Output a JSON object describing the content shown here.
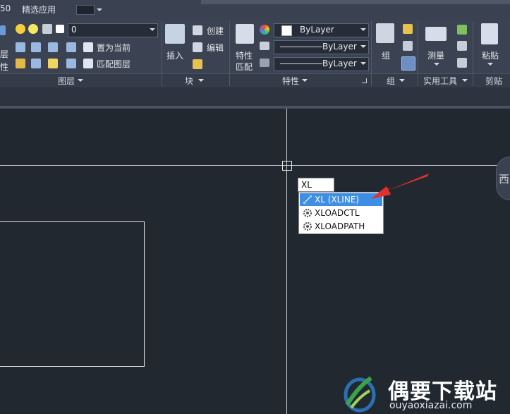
{
  "topbar": {
    "left_partial": "50",
    "menu_item": "精选应用"
  },
  "ribbon": {
    "layer": {
      "combo_value": "0",
      "labels": [
        "置为当前",
        "匹配图层"
      ],
      "left_cut_labels": [
        "层",
        "性"
      ],
      "group_label": "图层"
    },
    "block": {
      "insert_label": "插入",
      "create_label": "创建",
      "edit_label": "编辑",
      "group_label": "块"
    },
    "properties": {
      "match_label_1": "特性",
      "match_label_2": "匹配",
      "color_value": "ByLayer",
      "linetype_value": "ByLayer",
      "lineweight_value": "ByLayer",
      "group_label": "特性"
    },
    "group": {
      "label": "组",
      "group_label": "组"
    },
    "utilities": {
      "measure_label": "测量",
      "group_label": "实用工具"
    },
    "clipboard": {
      "paste_label": "粘贴",
      "group_label": "剪贴板"
    }
  },
  "canvas": {
    "viewcube_label": "西",
    "command_input": "XL",
    "suggestions": [
      {
        "label": "XL (XLINE)",
        "icon": "xline-icon",
        "selected": true
      },
      {
        "label": "XLOADCTL",
        "icon": "gear-icon",
        "selected": false
      },
      {
        "label": "XLOADPATH",
        "icon": "gear-icon",
        "selected": false
      }
    ]
  },
  "watermark": {
    "brand": "偶要下载站",
    "url": "ouyaoxiazai.com"
  },
  "colors": {
    "canvas_bg": "#212830",
    "ribbon_bg": "#3b4353",
    "highlight": "#3d8ee4",
    "arrow": "#e2302f"
  }
}
